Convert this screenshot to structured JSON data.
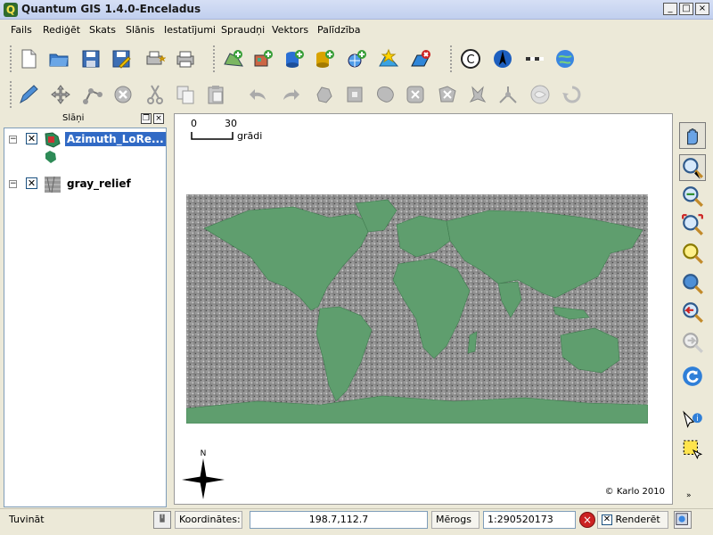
{
  "window": {
    "app_icon_glyph": "Q",
    "title": "Quantum GIS 1.4.0-Enceladus",
    "controls": {
      "minimize": "_",
      "maximize": "□",
      "close": "×"
    }
  },
  "menu": [
    "Fails",
    "Rediģēt",
    "Skats",
    "Slānis",
    "Iestatījumi",
    "Spraudņi",
    "Vektors",
    "Palīdzība"
  ],
  "toolbar_icons_row1": [
    "new-project-icon",
    "open-project-icon",
    "save-project-icon",
    "save-as-icon",
    "print-composer-icon",
    "print-icon",
    "add-vector-layer-icon",
    "add-raster-layer-icon",
    "add-postgis-layer-icon",
    "add-spatialite-layer-icon",
    "add-wms-layer-icon",
    "new-vector-layer-icon",
    "remove-layer-icon",
    "copyright-label-icon",
    "north-arrow-icon",
    "scale-bar-icon",
    "georeferencer-icon"
  ],
  "toolbar_icons_row2": [
    "toggle-editing-icon",
    "move-feature-icon",
    "node-tool-icon",
    "delete-selected-icon",
    "cut-features-icon",
    "copy-features-icon",
    "paste-features-icon",
    "undo-icon",
    "redo-icon",
    "simplify-feature-icon",
    "add-ring-icon",
    "add-island-icon",
    "delete-ring-icon",
    "delete-part-icon",
    "reshape-features-icon",
    "split-features-icon",
    "merge-features-icon",
    "merge-attributes-icon",
    "rotate-point-symbols-icon"
  ],
  "layers_panel": {
    "title": "Slāņi",
    "layers": [
      {
        "name": "Azimuth_LoRe...",
        "visible_mark": "✕",
        "expander": "−",
        "selected": true,
        "color": "#2e8b57"
      },
      {
        "name": "gray_relief",
        "visible_mark": "✕",
        "expander": "−",
        "selected": false,
        "color": "#888888"
      }
    ]
  },
  "map": {
    "scalebar": {
      "min_label": "0",
      "max_label": "30",
      "unit": "grādi"
    },
    "copyright": "© Karlo 2010",
    "north_label": "N",
    "land_color": "#5f9e6e",
    "sea_color": "#a9a9a9"
  },
  "right_tools": [
    "pan-icon",
    "zoom-in-icon",
    "zoom-out-icon",
    "zoom-full-icon",
    "zoom-to-selection-icon",
    "zoom-to-layer-icon",
    "zoom-last-icon",
    "zoom-next-icon",
    "refresh-icon",
    "identify-icon",
    "select-features-icon"
  ],
  "statusbar": {
    "message": "Tuvināt",
    "coords_label": "Koordinātes:",
    "coords_value": "198.7,112.7",
    "scale_label": "Mērogs",
    "scale_value": "1:290520173",
    "render_label": "Renderēt",
    "render_checked": "✕"
  }
}
